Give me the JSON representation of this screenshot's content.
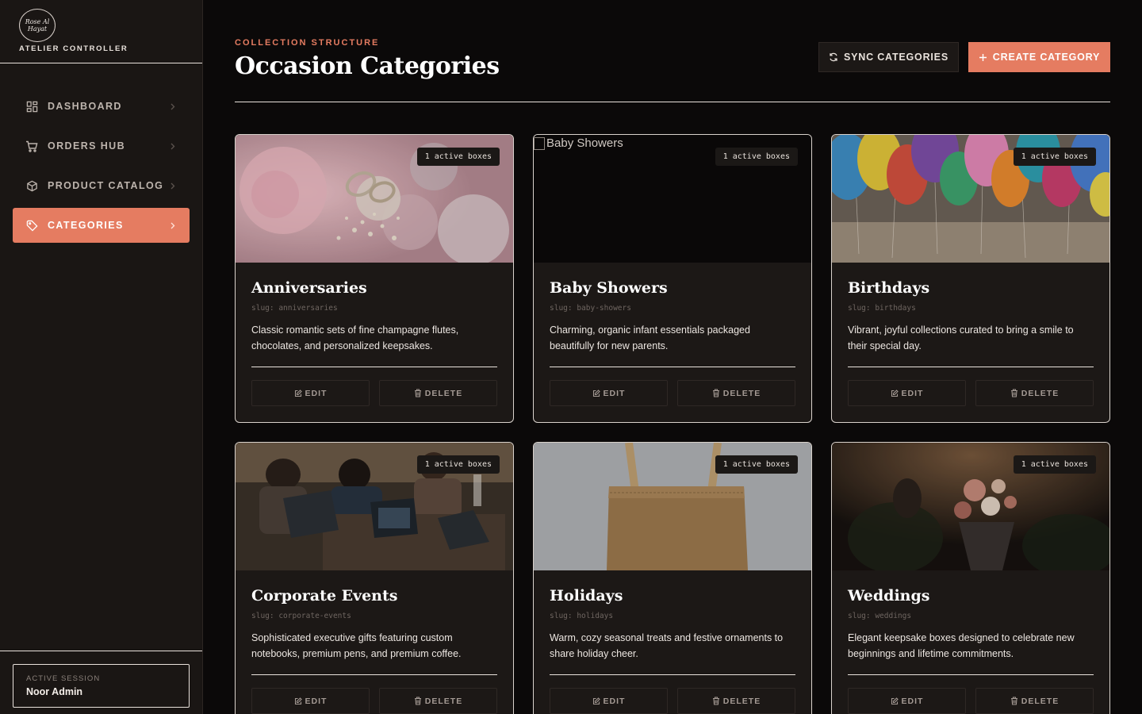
{
  "brand": {
    "logo_text_lines": [
      "Rose Al",
      "Hayat"
    ],
    "subtitle": "ATELIER CONTROLLER"
  },
  "sidebar": {
    "items": [
      {
        "label": "DASHBOARD",
        "icon": "dashboard-grid-icon",
        "active": false
      },
      {
        "label": "ORDERS HUB",
        "icon": "cart-icon",
        "active": false
      },
      {
        "label": "PRODUCT CATALOG",
        "icon": "box-icon",
        "active": false
      },
      {
        "label": "CATEGORIES",
        "icon": "tag-icon",
        "active": true
      }
    ],
    "session": {
      "label": "ACTIVE SESSION",
      "user": "Noor Admin"
    }
  },
  "header": {
    "eyebrow": "COLLECTION STRUCTURE",
    "title": "Occasion Categories",
    "sync_label": "SYNC CATEGORIES",
    "create_label": "CREATE CATEGORY"
  },
  "colors": {
    "accent": "#e57c61",
    "background": "#0b0909",
    "card": "#1c1816"
  },
  "cards": [
    {
      "title": "Anniversaries",
      "slug": "slug: anniversaries",
      "badge": "1 active boxes",
      "description": "Classic romantic sets of fine champagne flutes, chocolates, and personalized keepsakes.",
      "image": "rings-on-flowers",
      "edit": "EDIT",
      "delete": "DELETE"
    },
    {
      "title": "Baby Showers",
      "slug": "slug: baby-showers",
      "badge": "1 active boxes",
      "description": "Charming, organic infant essentials packaged beautifully for new parents.",
      "image": "broken-image",
      "image_alt": "Baby Showers",
      "edit": "EDIT",
      "delete": "DELETE"
    },
    {
      "title": "Birthdays",
      "slug": "slug: birthdays",
      "badge": "1 active boxes",
      "description": "Vibrant, joyful collections curated to bring a smile to their special day.",
      "image": "balloons",
      "edit": "EDIT",
      "delete": "DELETE"
    },
    {
      "title": "Corporate Events",
      "slug": "slug: corporate-events",
      "badge": "1 active boxes",
      "description": "Sophisticated executive gifts featuring custom notebooks, premium pens, and premium coffee.",
      "image": "people-with-laptops",
      "edit": "EDIT",
      "delete": "DELETE"
    },
    {
      "title": "Holidays",
      "slug": "slug: holidays",
      "badge": "1 active boxes",
      "description": "Warm, cozy seasonal treats and festive ornaments to share holiday cheer.",
      "image": "kraft-tote-bag",
      "edit": "EDIT",
      "delete": "DELETE"
    },
    {
      "title": "Weddings",
      "slug": "slug: weddings",
      "badge": "1 active boxes",
      "description": "Elegant keepsake boxes designed to celebrate new beginnings and lifetime commitments.",
      "image": "wedding-bouquet",
      "edit": "EDIT",
      "delete": "DELETE"
    }
  ]
}
